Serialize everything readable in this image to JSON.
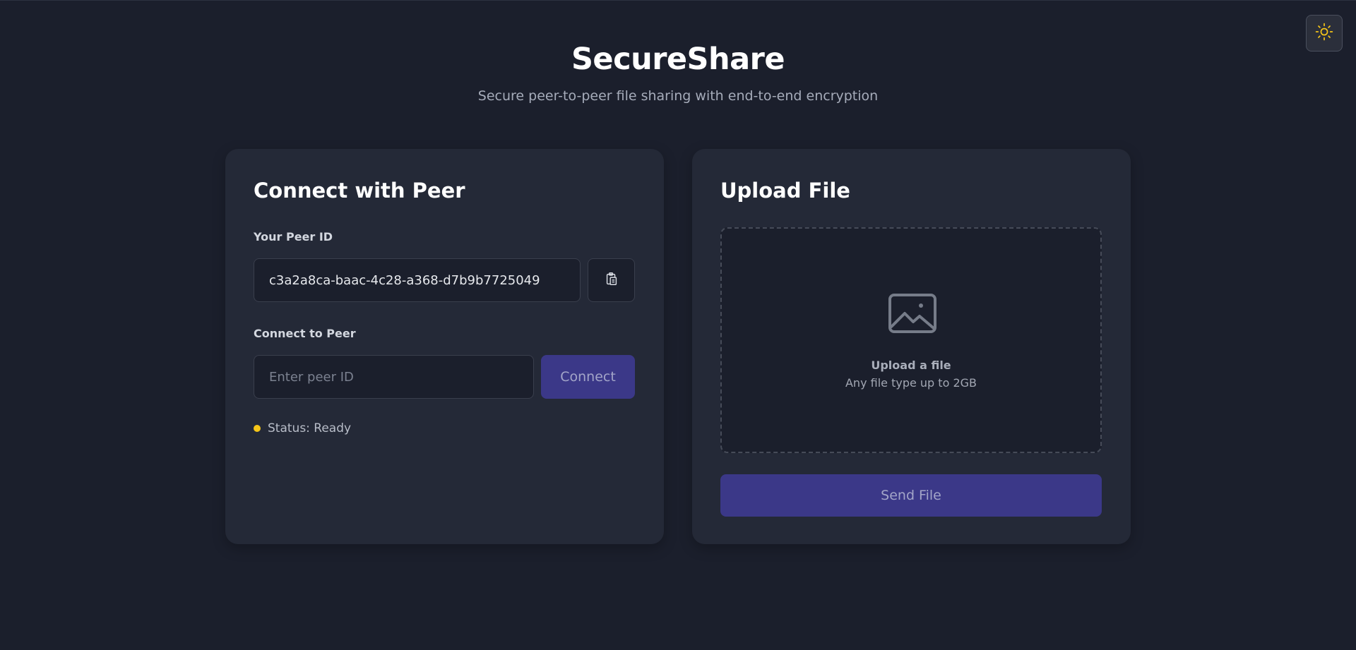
{
  "app": {
    "title": "SecureShare",
    "subtitle": "Secure peer-to-peer file sharing with end-to-end encryption",
    "theme_toggle_icon": "sun-icon"
  },
  "connect_card": {
    "title": "Connect with Peer",
    "your_peer_id_label": "Your Peer ID",
    "your_peer_id_value": "c3a2a8ca-baac-4c28-a368-d7b9b7725049",
    "copy_icon": "clipboard-copy-icon",
    "connect_to_peer_label": "Connect to Peer",
    "peer_id_placeholder": "Enter peer ID",
    "peer_id_value": "",
    "connect_button_label": "Connect",
    "status_text": "Status: Ready",
    "status_color": "#f5c518"
  },
  "upload_card": {
    "title": "Upload File",
    "dropzone_icon": "image-icon",
    "dropzone_title": "Upload a file",
    "dropzone_subtitle": "Any file type up to 2GB",
    "send_button_label": "Send File"
  },
  "colors": {
    "background": "#1b1f2c",
    "card": "#242937",
    "accent_button": "#3b3888",
    "status_ready": "#f5c518",
    "sun": "#f5c518"
  }
}
